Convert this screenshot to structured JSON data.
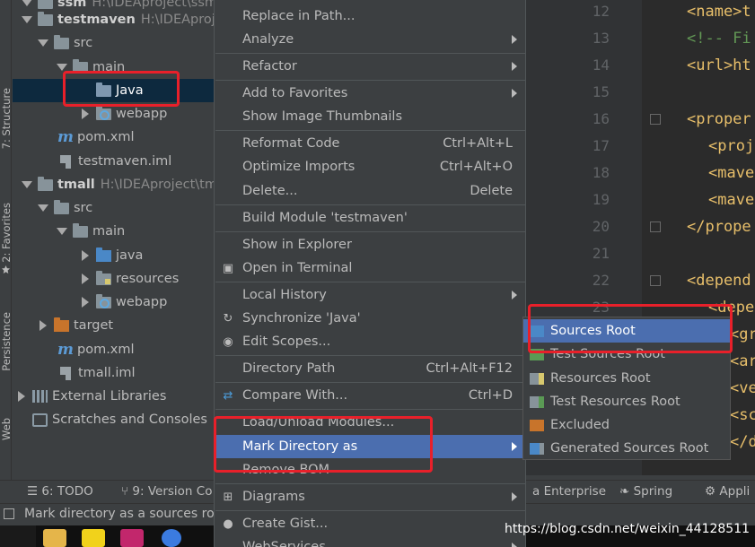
{
  "left_strip": {
    "tabs": [
      "7: Structure",
      "2: Favorites",
      "Persistence",
      "Web"
    ]
  },
  "tree": {
    "rows": [
      {
        "label": "ssm",
        "path": "H:\\IDEAproject\\ssm"
      },
      {
        "label": "testmaven",
        "path": "H:\\IDEAproject"
      },
      {
        "label": "src"
      },
      {
        "label": "main"
      },
      {
        "label": "Java"
      },
      {
        "label": "webapp"
      },
      {
        "label": "pom.xml"
      },
      {
        "label": "testmaven.iml"
      },
      {
        "label": "tmall",
        "path": "H:\\IDEAproject\\tm"
      },
      {
        "label": "src"
      },
      {
        "label": "main"
      },
      {
        "label": "java"
      },
      {
        "label": "resources"
      },
      {
        "label": "webapp"
      },
      {
        "label": "target"
      },
      {
        "label": "pom.xml"
      },
      {
        "label": "tmall.iml"
      },
      {
        "label": "External Libraries"
      },
      {
        "label": "Scratches and Consoles"
      }
    ]
  },
  "menu": {
    "items": [
      {
        "label": "Replace in Path...",
        "shortcut": ""
      },
      {
        "label": "Analyze",
        "shortcut": ""
      },
      {
        "label": "Refactor",
        "shortcut": ""
      },
      {
        "label": "Add to Favorites",
        "shortcut": ""
      },
      {
        "label": "Show Image Thumbnails",
        "shortcut": ""
      },
      {
        "label": "Reformat Code",
        "shortcut": "Ctrl+Alt+L"
      },
      {
        "label": "Optimize Imports",
        "shortcut": "Ctrl+Alt+O"
      },
      {
        "label": "Delete...",
        "shortcut": "Delete"
      },
      {
        "label": "Build Module 'testmaven'",
        "shortcut": ""
      },
      {
        "label": "Show in Explorer",
        "shortcut": ""
      },
      {
        "label": "Open in Terminal",
        "shortcut": ""
      },
      {
        "label": "Local History",
        "shortcut": ""
      },
      {
        "label": "Synchronize 'Java'",
        "shortcut": ""
      },
      {
        "label": "Edit Scopes...",
        "shortcut": ""
      },
      {
        "label": "Directory Path",
        "shortcut": "Ctrl+Alt+F12"
      },
      {
        "label": "Compare With...",
        "shortcut": "Ctrl+D"
      },
      {
        "label": "Load/Unload Modules...",
        "shortcut": ""
      },
      {
        "label": "Mark Directory as",
        "shortcut": ""
      },
      {
        "label": "Remove BOM",
        "shortcut": ""
      },
      {
        "label": "Diagrams",
        "shortcut": ""
      },
      {
        "label": "Create Gist...",
        "shortcut": ""
      },
      {
        "label": "WebServices",
        "shortcut": ""
      }
    ]
  },
  "submenu": {
    "items": [
      {
        "label": "Sources Root"
      },
      {
        "label": "Test Sources Root"
      },
      {
        "label": "Resources Root"
      },
      {
        "label": "Test Resources Root"
      },
      {
        "label": "Excluded"
      },
      {
        "label": "Generated Sources Root"
      }
    ]
  },
  "editor": {
    "line_numbers": [
      "12",
      "13",
      "14",
      "15",
      "16",
      "17",
      "18",
      "19",
      "20",
      "21",
      "22",
      "23"
    ],
    "lines": [
      "<name>t",
      "<!-- Fi",
      "<url>ht",
      "",
      "<proper",
      "<proj",
      "<mave",
      "<mave",
      "</prope",
      "",
      "<depend",
      "<depe"
    ],
    "extra_lines": [
      "<gr",
      "<ar",
      "<ve",
      "<sc",
      "</der"
    ]
  },
  "toolbar": {
    "todo": "6: TODO",
    "version_control": "9: Version Co",
    "enterprise": "a Enterprise",
    "spring": "Spring",
    "applications": "Appli"
  },
  "status": {
    "text": "Mark directory as a sources ro"
  },
  "watermark": "https://blog.csdn.net/weixin_44128511",
  "colors": {
    "background": "#3c3f41",
    "selection": "#4b6eaf",
    "tree_selection": "#0d293e",
    "editor_bg": "#2b2b2b",
    "tag": "#e8bf6a",
    "annotation_red": "#e8202a"
  }
}
